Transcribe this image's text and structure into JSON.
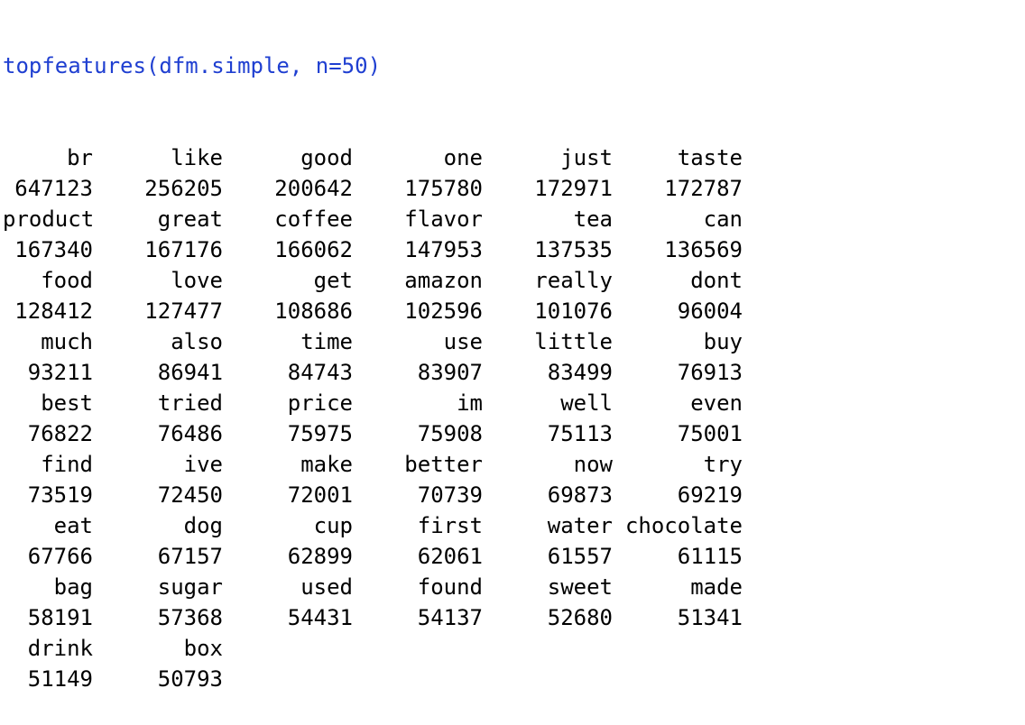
{
  "console": {
    "command": "topfeatures(dfm.simple, n=50)",
    "features": [
      {
        "term": "br",
        "count": "647123"
      },
      {
        "term": "like",
        "count": "256205"
      },
      {
        "term": "good",
        "count": "200642"
      },
      {
        "term": "one",
        "count": "175780"
      },
      {
        "term": "just",
        "count": "172971"
      },
      {
        "term": "taste",
        "count": "172787"
      },
      {
        "term": "product",
        "count": "167340"
      },
      {
        "term": "great",
        "count": "167176"
      },
      {
        "term": "coffee",
        "count": "166062"
      },
      {
        "term": "flavor",
        "count": "147953"
      },
      {
        "term": "tea",
        "count": "137535"
      },
      {
        "term": "can",
        "count": "136569"
      },
      {
        "term": "food",
        "count": "128412"
      },
      {
        "term": "love",
        "count": "127477"
      },
      {
        "term": "get",
        "count": "108686"
      },
      {
        "term": "amazon",
        "count": "102596"
      },
      {
        "term": "really",
        "count": "101076"
      },
      {
        "term": "dont",
        "count": "96004"
      },
      {
        "term": "much",
        "count": "93211"
      },
      {
        "term": "also",
        "count": "86941"
      },
      {
        "term": "time",
        "count": "84743"
      },
      {
        "term": "use",
        "count": "83907"
      },
      {
        "term": "little",
        "count": "83499"
      },
      {
        "term": "buy",
        "count": "76913"
      },
      {
        "term": "best",
        "count": "76822"
      },
      {
        "term": "tried",
        "count": "76486"
      },
      {
        "term": "price",
        "count": "75975"
      },
      {
        "term": "im",
        "count": "75908"
      },
      {
        "term": "well",
        "count": "75113"
      },
      {
        "term": "even",
        "count": "75001"
      },
      {
        "term": "find",
        "count": "73519"
      },
      {
        "term": "ive",
        "count": "72450"
      },
      {
        "term": "make",
        "count": "72001"
      },
      {
        "term": "better",
        "count": "70739"
      },
      {
        "term": "now",
        "count": "69873"
      },
      {
        "term": "try",
        "count": "69219"
      },
      {
        "term": "eat",
        "count": "67766"
      },
      {
        "term": "dog",
        "count": "67157"
      },
      {
        "term": "cup",
        "count": "62899"
      },
      {
        "term": "first",
        "count": "62061"
      },
      {
        "term": "water",
        "count": "61557"
      },
      {
        "term": "chocolate",
        "count": "61115"
      },
      {
        "term": "bag",
        "count": "58191"
      },
      {
        "term": "sugar",
        "count": "57368"
      },
      {
        "term": "used",
        "count": "54431"
      },
      {
        "term": "found",
        "count": "54137"
      },
      {
        "term": "sweet",
        "count": "52680"
      },
      {
        "term": "made",
        "count": "51341"
      },
      {
        "term": "drink",
        "count": "51149"
      },
      {
        "term": "box",
        "count": "50793"
      }
    ]
  },
  "colors": {
    "command": "#1f3fd1",
    "output": "#000000",
    "background": "#ffffff"
  }
}
